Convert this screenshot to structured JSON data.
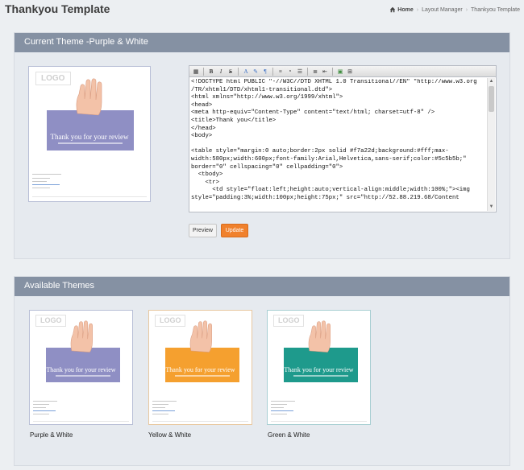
{
  "page": {
    "title": "Thankyou Template"
  },
  "breadcrumb": {
    "home": "Home",
    "items": [
      "Layout Manager",
      "Thankyou Template"
    ]
  },
  "current_theme": {
    "header": "Current Theme -Purple & White",
    "preview": {
      "logo": "LOGO",
      "hero_title": "Thank you for your review",
      "hero_color": "#8f8fc4",
      "border_color": "#b8bfd6"
    }
  },
  "editor": {
    "toolbar_icons": [
      "preview-icon",
      "bold-icon",
      "italic-icon",
      "strikethrough-icon",
      "font-color-icon",
      "highlight-icon",
      "format-icon",
      "align-icon",
      "font-size-icon",
      "list-icon",
      "outdent-icon",
      "image-icon",
      "table-icon"
    ],
    "code": "<!DOCTYPE html PUBLIC \"-//W3C//DTD XHTML 1.0 Transitional//EN\" \"http://www.w3.org\n/TR/xhtml1/DTD/xhtml1-transitional.dtd\">\n<html xmlns=\"http://www.w3.org/1999/xhtml\">\n<head>\n<meta http-equiv=\"Content-Type\" content=\"text/html; charset=utf-8\" />\n<title>Thank you</title>\n</head>\n<body>\n\n<table style=\"margin:0 auto;border:2px solid #f7a22d;background:#fff;max-\nwidth:580px;width:600px;font-family:Arial,Helvetica,sans-serif;color:#5c5b5b;\"\nborder=\"0\" cellspacing=\"0\" cellpadding=\"0\">\n  <tbody>\n    <tr>\n      <td style=\"float:left;height:auto;vertical-align:middle;width:100%;\"><img\nstyle=\"padding:3%;width:100px;height:75px;\" src=\"http://52.88.219.68/Content"
  },
  "actions": {
    "preview_label": "Preview",
    "update_label": "Update",
    "update_color": "#f0812d"
  },
  "available_themes": {
    "header": "Available Themes",
    "themes": [
      {
        "name": "Purple & White",
        "logo": "LOGO",
        "hero_title": "Thank you for your review",
        "hero_color": "#8f8fc4",
        "border_color": "#b8bfd6"
      },
      {
        "name": "Yellow & White",
        "logo": "LOGO",
        "hero_title": "Thank you for your review",
        "hero_color": "#f5a02f",
        "border_color": "#e8c8a0"
      },
      {
        "name": "Green & White",
        "logo": "LOGO",
        "hero_title": "Thank you for your review",
        "hero_color": "#1e9a8c",
        "border_color": "#a8cfd2"
      }
    ]
  }
}
